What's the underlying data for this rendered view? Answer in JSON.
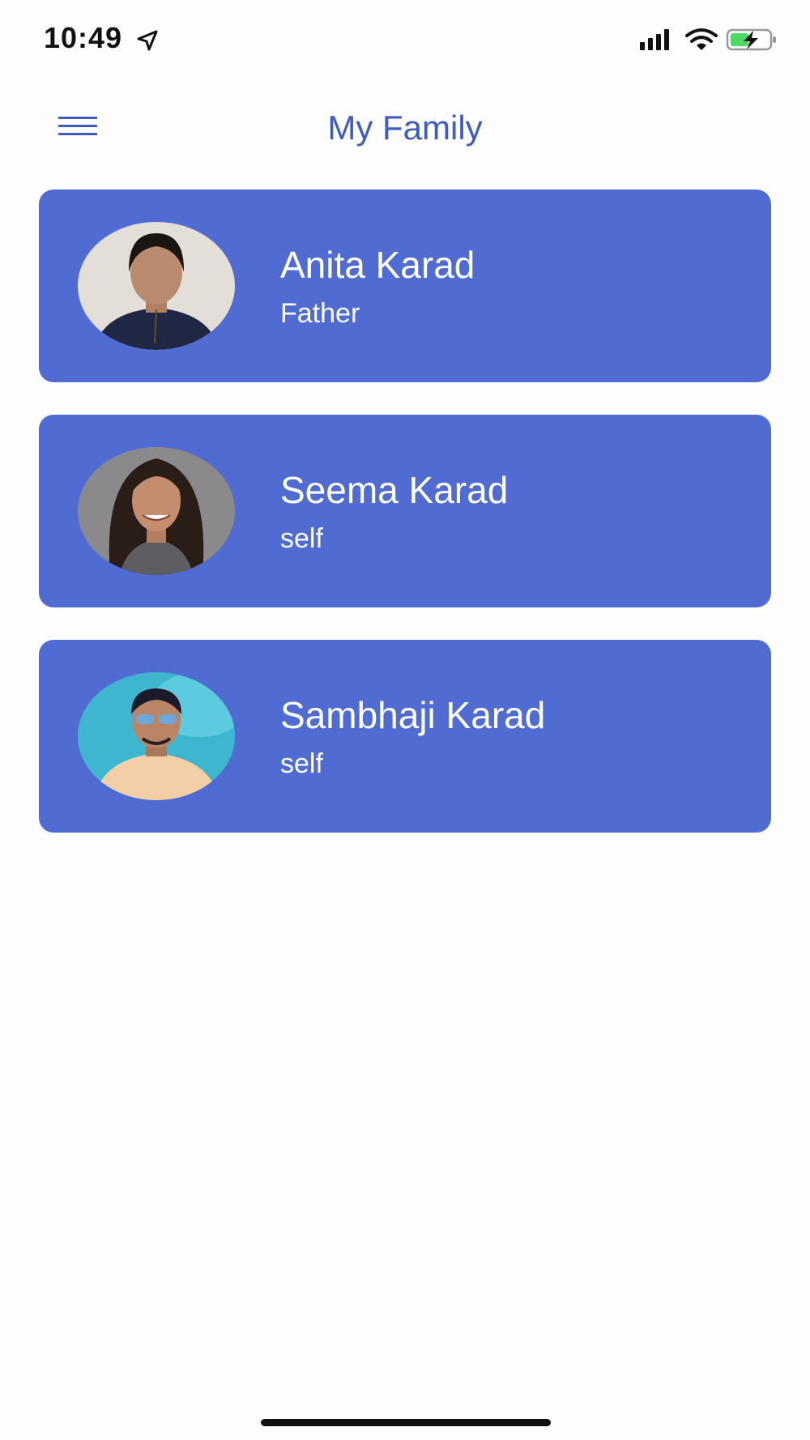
{
  "status_bar": {
    "time": "10:49",
    "location_icon": "location-arrow-icon",
    "signal_icon": "cellular-signal-icon",
    "wifi_icon": "wifi-icon",
    "battery_icon": "battery-charging-icon"
  },
  "header": {
    "menu_icon": "hamburger-menu-icon",
    "title": "My Family"
  },
  "members": [
    {
      "name": "Anita Karad",
      "relation": "Father",
      "avatar": "profile-photo"
    },
    {
      "name": "Seema Karad",
      "relation": "self",
      "avatar": "profile-photo"
    },
    {
      "name": "Sambhaji Karad",
      "relation": "self",
      "avatar": "profile-photo"
    }
  ],
  "colors": {
    "accent": "#3e5cbf",
    "card_background": "#506cd3",
    "card_text": "#ffffff",
    "page_background": "#fdfdfd"
  }
}
